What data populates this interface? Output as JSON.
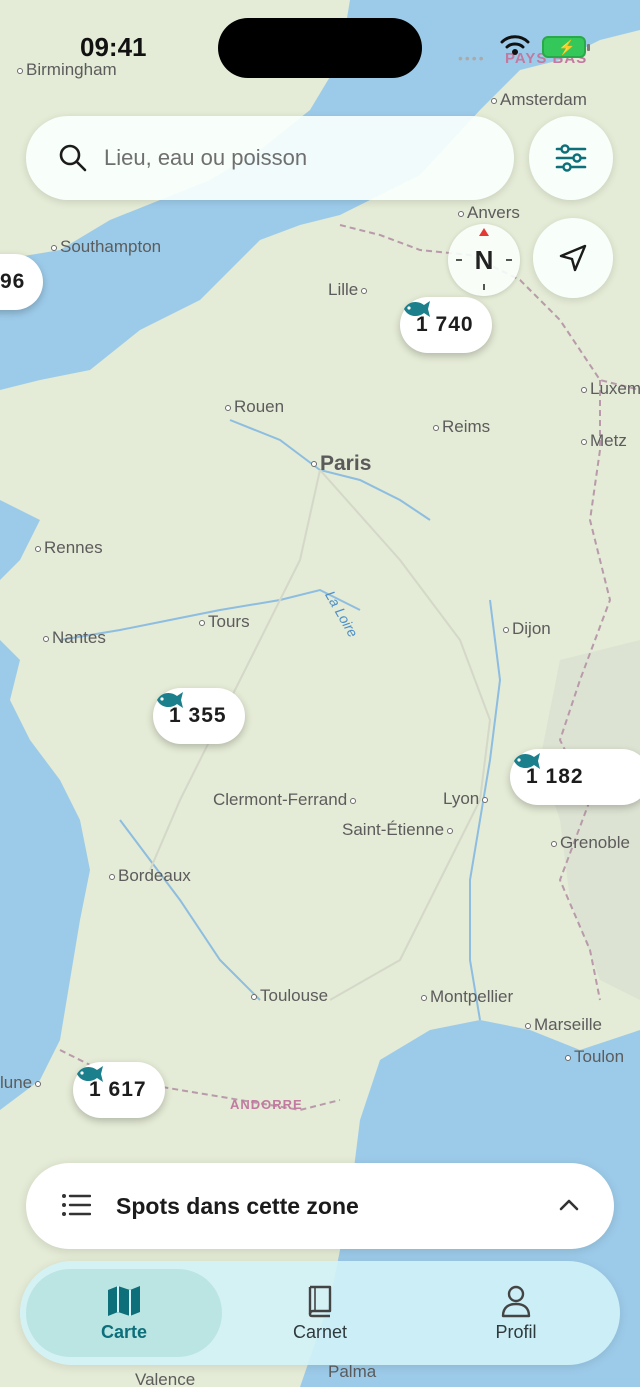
{
  "status_bar": {
    "time": "09:41",
    "battery": "⚡"
  },
  "search": {
    "placeholder": "Lieu, eau ou poisson"
  },
  "map": {
    "cities": {
      "birmingham": "Birmingham",
      "amsterdam": "Amsterdam",
      "southampton": "Southampton",
      "anvers": "Anvers",
      "lille": "Lille",
      "rouen": "Rouen",
      "reims": "Reims",
      "luxembourg": "Luxem",
      "metz": "Metz",
      "paris": "Paris",
      "rennes": "Rennes",
      "tours": "Tours",
      "nantes": "Nantes",
      "dijon": "Dijon",
      "clermont": "Clermont-Ferrand",
      "lyon": "Lyon",
      "saint_etienne": "Saint-Étienne",
      "grenoble": "Grenoble",
      "bordeaux": "Bordeaux",
      "toulouse": "Toulouse",
      "montpellier": "Montpellier",
      "marseille": "Marseille",
      "toulon": "Toulon",
      "pamplona": "lune",
      "palma": "Palma",
      "valence": "Valence"
    },
    "countries": {
      "pays_bas": "PAYS BAS",
      "andorre": "ANDORRE"
    },
    "rivers": {
      "loire": "La Loire"
    },
    "compass_label": "N",
    "clusters": [
      {
        "id": "west-edge",
        "count": "96"
      },
      {
        "id": "lille",
        "count": "1 740"
      },
      {
        "id": "poitou",
        "count": "1 355"
      },
      {
        "id": "alps",
        "count": "1 182"
      },
      {
        "id": "pyrenees",
        "count": "1 617"
      }
    ]
  },
  "sheet": {
    "title": "Spots dans cette zone"
  },
  "tabs": [
    {
      "label": "Carte",
      "active": true
    },
    {
      "label": "Carnet",
      "active": false
    },
    {
      "label": "Profil",
      "active": false
    }
  ],
  "colors": {
    "accent": "#0d6f7a",
    "water": "#8cc4e8",
    "land": "#e6ecd9"
  }
}
